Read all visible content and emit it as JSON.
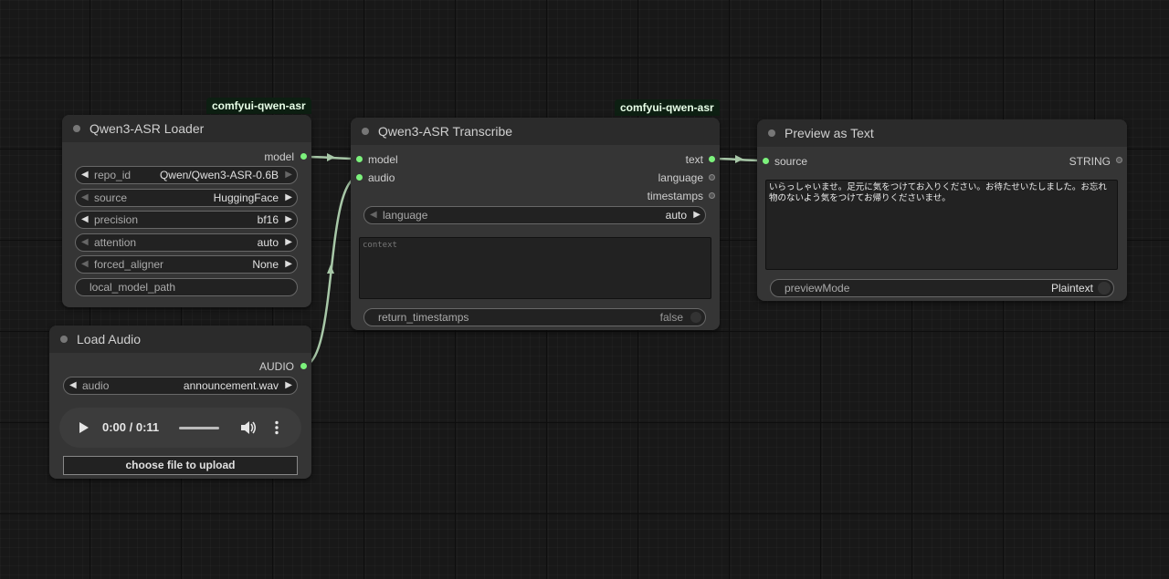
{
  "colors": {
    "canvas": "#181818",
    "node_body": "#353535",
    "node_title": "#2b2b2b",
    "connected_pin": "#7cf27c",
    "badge_bg": "#0d1f12",
    "link": "#a8c8a8"
  },
  "nodes": {
    "loader": {
      "badge": "comfyui-qwen-asr",
      "title": "Qwen3-ASR Loader",
      "output": "model",
      "widgets": [
        {
          "label": "repo_id",
          "value": "Qwen/Qwen3-ASR-0.6B"
        },
        {
          "label": "source",
          "value": "HuggingFace"
        },
        {
          "label": "precision",
          "value": "bf16"
        },
        {
          "label": "attention",
          "value": "auto"
        },
        {
          "label": "forced_aligner",
          "value": "None"
        }
      ],
      "text_widget": "local_model_path"
    },
    "load_audio": {
      "title": "Load Audio",
      "output": "AUDIO",
      "widget": {
        "label": "audio",
        "value": "announcement.wav"
      },
      "player_time": "0:00 / 0:11",
      "upload_button": "choose file to upload"
    },
    "transcribe": {
      "badge": "comfyui-qwen-asr",
      "title": "Qwen3-ASR Transcribe",
      "inputs": [
        "model",
        "audio"
      ],
      "outputs": [
        "text",
        "language",
        "timestamps"
      ],
      "language_widget": {
        "label": "language",
        "value": "auto"
      },
      "context_placeholder": "context",
      "timestamps_toggle": {
        "label": "return_timestamps",
        "value": "false"
      }
    },
    "preview": {
      "title": "Preview as Text",
      "input": "source",
      "output": "STRING",
      "text": "いらっしゃいませ。足元に気をつけてお入りください。お待たせいたしました。お忘れ物のないよう気をつけてお帰りくださいませ。",
      "mode_widget": {
        "label": "previewMode",
        "value": "Plaintext"
      }
    }
  },
  "icons": {
    "play": "play-icon",
    "volume": "volume-icon",
    "more": "more-vertical-icon"
  }
}
